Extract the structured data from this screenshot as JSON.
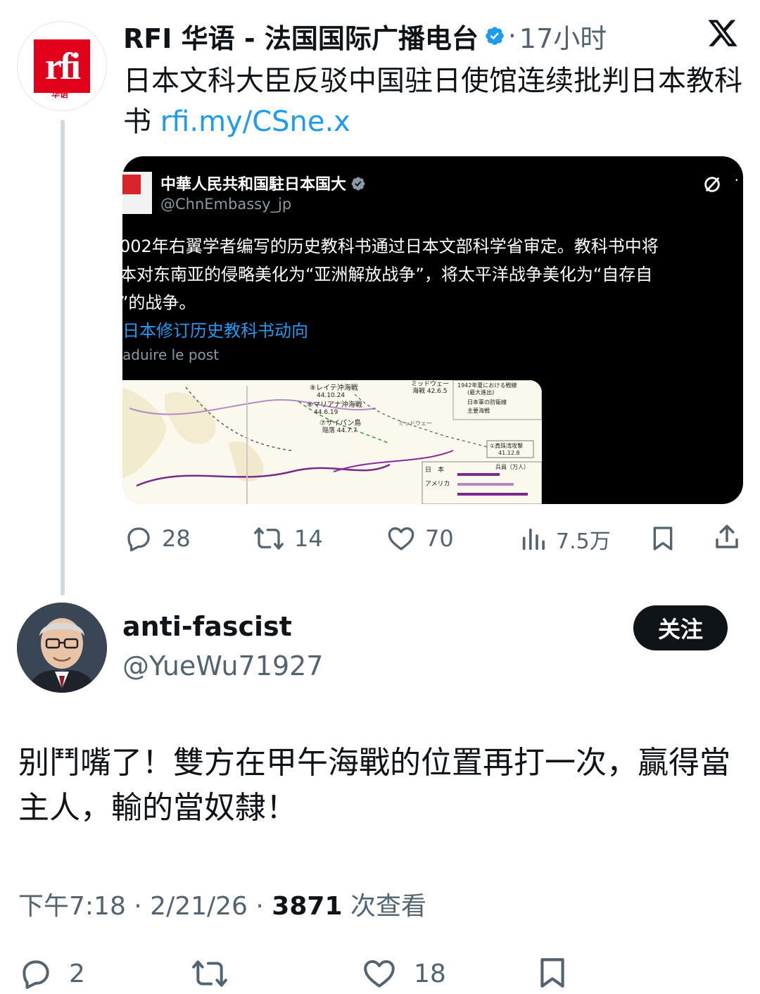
{
  "parent_tweet": {
    "author_name": "RFI 华语 - 法国国际广播电台",
    "avatar_logo_text": "rfi",
    "avatar_sub_text": "华语",
    "separator": "·",
    "age": "17小时",
    "text": "日本文科大臣反驳中国驻日使馆连续批判日本教科书",
    "link": "rfi.my/CSne.x",
    "embedded_post": {
      "name": "中華人民共和国駐日本国大",
      "handle": "@ChnEmbassy_jp",
      "lines": [
        "002年右翼学者编写的历史教科书通过日本文部科学省审定。教科书中将",
        "本对东南亚的侵略美化为“亚洲解放战争”，将太平洋战争美化为“自存自",
        "”的战争。"
      ],
      "link_text": "日本修订历史教科书动向",
      "translate_text": "aduire le post",
      "map_labels": {
        "leyte": "⑧レイテ沖海戦",
        "leyte_date": "44.10.24",
        "marianas": "⑥マリアナ沖海戦",
        "marianas_date": "44.6.19",
        "saipan": "⑦サイパン島",
        "saipan_date": "陥落 44.7.7",
        "midway": "ミッドウェー",
        "midway_battle": "海戦 42.6.5",
        "summer": "1942年夏における戦線",
        "summer_sub": "(最大進出)",
        "legend_1": "日本軍の防衛線",
        "legend_2": "主要海戦",
        "pearl": "①真珠湾攻撃",
        "pearl_date": "41.12.8",
        "japan": "日　本",
        "america": "アメリカ",
        "soldiers": "兵員（万人）"
      }
    },
    "actions": {
      "replies": "28",
      "reposts": "14",
      "likes": "70",
      "views": "7.5万"
    }
  },
  "reply_tweet": {
    "author_name": "anti-fascist",
    "handle": "@YueWu71927",
    "follow_label": "关注",
    "text": "别鬥嘴了！雙方在甲午海戰的位置再打一次，贏得當主人，輸的當奴隸！",
    "time": "下午7:18 · 2/21/26 · ",
    "view_count": "3871",
    "view_label": " 次查看",
    "actions": {
      "replies": "2",
      "likes": "18"
    }
  },
  "colors": {
    "accent": "#1d9bf0",
    "rfi_red": "#e2001a",
    "secondary": "#536471",
    "text": "#0f1419"
  }
}
